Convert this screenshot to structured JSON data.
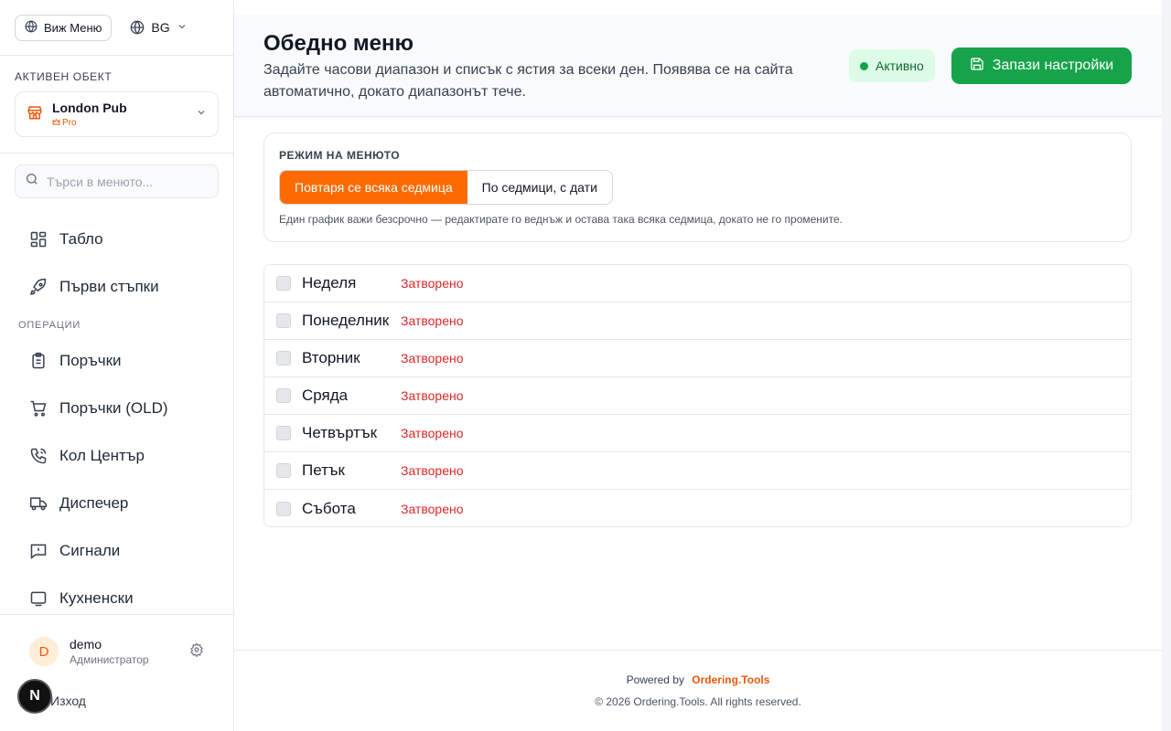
{
  "sidebar": {
    "view_menu_label": "Виж Меню",
    "language": "BG",
    "active_object_label": "АКТИВЕН ОБЕКТ",
    "object_name": "London Pub",
    "object_plan": "Pro",
    "search_placeholder": "Търси в менюто...",
    "items_top": [
      {
        "label": "Табло",
        "icon": "dashboard-icon"
      },
      {
        "label": "Първи стъпки",
        "icon": "rocket-icon"
      }
    ],
    "section_operations": "ОПЕРАЦИИ",
    "items_ops": [
      {
        "label": "Поръчки",
        "icon": "clipboard-icon"
      },
      {
        "label": "Поръчки (OLD)",
        "icon": "cart-icon"
      },
      {
        "label": "Кол Център",
        "icon": "phone-icon"
      },
      {
        "label": "Диспечер",
        "icon": "truck-icon"
      },
      {
        "label": "Сигнали",
        "icon": "alert-message-icon"
      },
      {
        "label": "Кухненски",
        "icon": "kitchen-screen-icon"
      }
    ],
    "user": {
      "initial": "D",
      "name": "demo",
      "role": "Администратор"
    },
    "logout_label": "Изход",
    "dev_badge": "N"
  },
  "header": {
    "title": "Обедно меню",
    "description": "Задайте часови диапазон и списък с ястия за всеки ден. Появява се на сайта автоматично, докато диапазонът тече.",
    "status": "Активно",
    "save_label": "Запази настройки"
  },
  "mode": {
    "label": "РЕЖИМ НА МЕНЮТО",
    "options": [
      "Повтаря се всяка седмица",
      "По седмици, с дати"
    ],
    "selected": "Повтаря се всяка седмица",
    "hint": "Един график важи безсрочно — редактирате го веднъж и остава така всяка седмица, докато не го промените."
  },
  "days": [
    {
      "name": "Неделя",
      "status": "Затворено"
    },
    {
      "name": "Понеделник",
      "status": "Затворено"
    },
    {
      "name": "Вторник",
      "status": "Затворено"
    },
    {
      "name": "Сряда",
      "status": "Затворено"
    },
    {
      "name": "Четвъртък",
      "status": "Затворено"
    },
    {
      "name": "Петък",
      "status": "Затворено"
    },
    {
      "name": "Събота",
      "status": "Затворено"
    }
  ],
  "footer": {
    "powered_by": "Powered by",
    "brand": "Ordering.Tools",
    "copyright": "© 2026 Ordering.Tools. All rights reserved."
  },
  "colors": {
    "accent": "#ff6a00",
    "save_green": "#16a34a",
    "closed_red": "#dc2626"
  }
}
